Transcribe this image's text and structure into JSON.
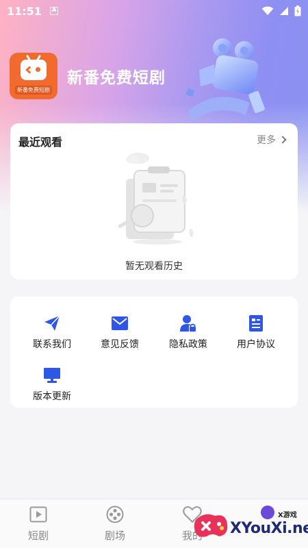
{
  "status_bar": {
    "time": "11:51",
    "notification_letter": "A"
  },
  "app": {
    "name": "新番免费短剧",
    "logo_caption": "新番免费短剧"
  },
  "recent": {
    "title": "最近观看",
    "more_label": "更多",
    "empty_text": "暂无观看历史"
  },
  "menu": {
    "items": [
      {
        "label": "联系我们",
        "icon": "send-icon"
      },
      {
        "label": "意见反馈",
        "icon": "mail-icon"
      },
      {
        "label": "隐私政策",
        "icon": "user-lock-icon"
      },
      {
        "label": "用户协议",
        "icon": "document-icon"
      },
      {
        "label": "版本更新",
        "icon": "monitor-icon"
      }
    ]
  },
  "tabs": [
    {
      "label": "短剧",
      "icon": "play-icon"
    },
    {
      "label": "剧场",
      "icon": "film-reel-icon"
    },
    {
      "label": "我的",
      "icon": "heart-icon"
    }
  ],
  "watermark": {
    "text": "XYouXi.net",
    "small": "X游戏"
  },
  "colors": {
    "accent_blue": "#2f57e6",
    "logo_orange": "#f26b2e",
    "tab_inactive": "#888888"
  }
}
